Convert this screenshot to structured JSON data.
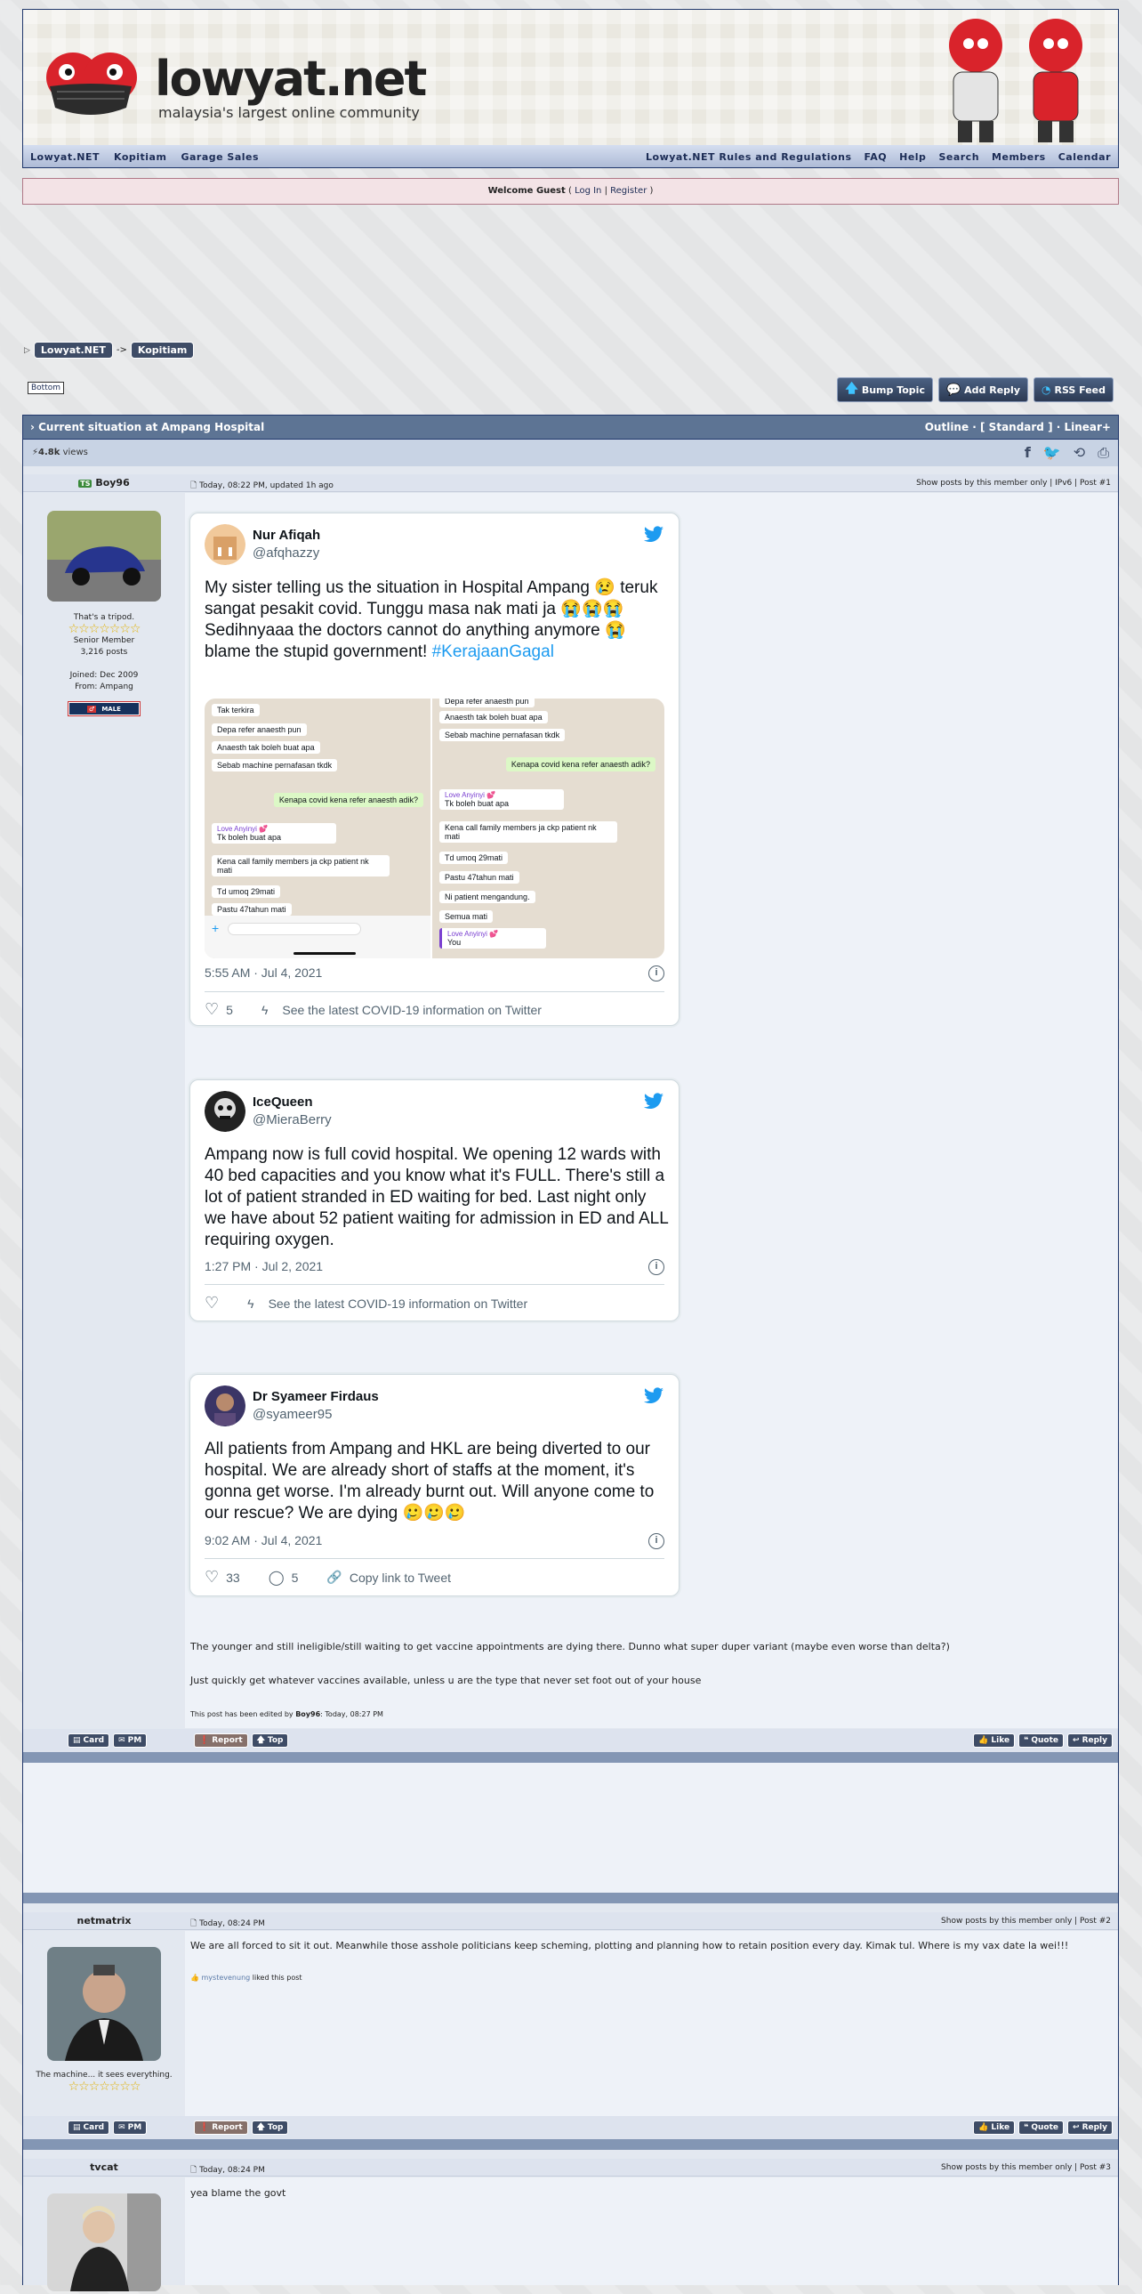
{
  "header": {
    "logo_text": "lowyat.net",
    "tagline": "malaysia's largest online community"
  },
  "nav": {
    "left": [
      "Lowyat.NET",
      "Kopitiam",
      "Garage Sales"
    ],
    "right": [
      "Lowyat.NET Rules and Regulations",
      "FAQ",
      "Help",
      "Search",
      "Members",
      "Calendar"
    ]
  },
  "welcome": {
    "prefix": "Welcome Guest",
    "login": "Log In",
    "sep": "|",
    "register": "Register"
  },
  "breadcrumb": [
    "Lowyat.NET",
    "Kopitiam"
  ],
  "bottom_label": "Bottom",
  "buttons": {
    "bump": "Bump Topic",
    "reply": "Add Reply",
    "rss": "RSS Feed"
  },
  "topic": {
    "title": "Current situation at Ampang Hospital",
    "modes": "Outline · [ Standard ] · Linear+",
    "views": "4.8k",
    "views_label": "views"
  },
  "posts": [
    {
      "author": "Boy96",
      "badge": "TS",
      "time": "Today, 08:22 PM, updated 1h ago",
      "links": "Show posts by this member only | IPv6 | Post #1",
      "tagline": "That's a tripod.",
      "rank": "Senior Member",
      "count": "3,216 posts",
      "joined": "Joined: Dec 2009",
      "from": "From: Ampang",
      "gender": "MALE",
      "text1": "The younger and still ineligible/still waiting to get vaccine appointments are dying there. Dunno what super duper variant (maybe even worse than delta?)",
      "text2": "Just quickly get whatever vaccines available, unless u are the type that never set foot out of your house",
      "edit_prefix": "This post has been edited by",
      "edit_user": "Boy96",
      "edit_time": ": Today, 08:27 PM"
    },
    {
      "author": "netmatrix",
      "time": "Today, 08:24 PM",
      "links": "Show posts by this member only | Post #2",
      "tagline": "The machine... it sees everything.",
      "text1": "We are all forced to sit it out. Meanwhile those asshole politicians keep scheming, plotting and planning how to retain position every day. Kimak tul. Where is my vax date la wei!!!",
      "liker": "mystevenung",
      "liked": "liked this post"
    },
    {
      "author": "tvcat",
      "time": "Today, 08:24 PM",
      "links": "Show posts by this member only | Post #3",
      "text1": "yea blame the govt"
    }
  ],
  "post_buttons": {
    "card": "Card",
    "pm": "PM",
    "report": "Report",
    "top": "Top",
    "like": "Like",
    "quote": "Quote",
    "reply": "Reply"
  },
  "tweets": [
    {
      "name": "Nur Afiqah",
      "handle": "@afqhazzy",
      "text": "My sister telling us the situation in Hospital Ampang 😢 teruk sangat pesakit covid. Tunggu masa nak mati ja 😭😭😭 Sedihnyaaa the doctors cannot do anything anymore 😭 blame the stupid government!",
      "hashtag": "#KerajaanGagal",
      "date": "5:55 AM · Jul 4, 2021",
      "likes": "5",
      "covid": "See the latest COVID-19 information on Twitter",
      "chat_left": [
        "Tak terkira",
        "Depa refer anaesth pun",
        "Anaesth tak boleh buat apa",
        "Sebab machine pernafasan tkdk",
        "Kenapa covid kena refer anaesth adik?",
        "Love Anyinyi 💕",
        "Tk boleh buat apa",
        "Kena call family members ja ckp patient nk mati",
        "Td umoq 29mati",
        "Pastu 47tahun mati"
      ],
      "chat_right": [
        "Depa refer anaesth pun",
        "Anaesth tak boleh buat apa",
        "Sebab machine pernafasan tkdk",
        "Kenapa covid kena refer anaesth adik?",
        "Love Anyinyi 💕",
        "Tk boleh buat apa",
        "Kena call family members ja ckp patient nk mati",
        "Td umoq 29mati",
        "Pastu 47tahun mati",
        "Ni patient mengandung.",
        "Semua mati",
        "Love Anyinyi 💕",
        "You"
      ]
    },
    {
      "name": "IceQueen",
      "handle": "@MieraBerry",
      "text": "Ampang now is full covid hospital. We opening 12 wards with 40 bed capacities and you know what it's FULL. There's still a lot of patient stranded in ED waiting for bed. Last night only we have about 52 patient waiting for admission in ED and ALL requiring oxygen.",
      "date": "1:27 PM · Jul 2, 2021",
      "covid": "See the latest COVID-19 information on Twitter"
    },
    {
      "name": "Dr Syameer Firdaus",
      "handle": "@syameer95",
      "text": "All patients from Ampang and HKL are being diverted to our hospital. We are already short of staffs at the moment, it's gonna get worse. I'm already burnt out. Will anyone come to our rescue? We are dying 🥲🥲🥲",
      "date": "9:02 AM · Jul 4, 2021",
      "likes": "33",
      "replies": "5",
      "copy": "Copy link to Tweet"
    }
  ],
  "colors": {
    "frame": "#20376b",
    "topic_bar": "#5d7494",
    "twitter_blue": "#1d9bf0"
  }
}
